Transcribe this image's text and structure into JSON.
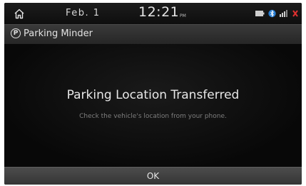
{
  "status_bar": {
    "home_icon": "home-icon",
    "date": "Feb. 1",
    "time": "12:21",
    "ampm": "PM",
    "icons": [
      "battery-icon",
      "bluetooth-icon",
      "signal-icon",
      "mute-icon"
    ],
    "colors": {
      "bluetooth": "#2a7fd4",
      "mute": "#e03030"
    }
  },
  "header": {
    "icon": "parking-icon",
    "icon_glyph": "P",
    "title": "Parking Minder"
  },
  "dialog": {
    "title": "Parking Location Transferred",
    "message": "Check the vehicle's location from your phone."
  },
  "footer": {
    "ok_label": "OK"
  }
}
